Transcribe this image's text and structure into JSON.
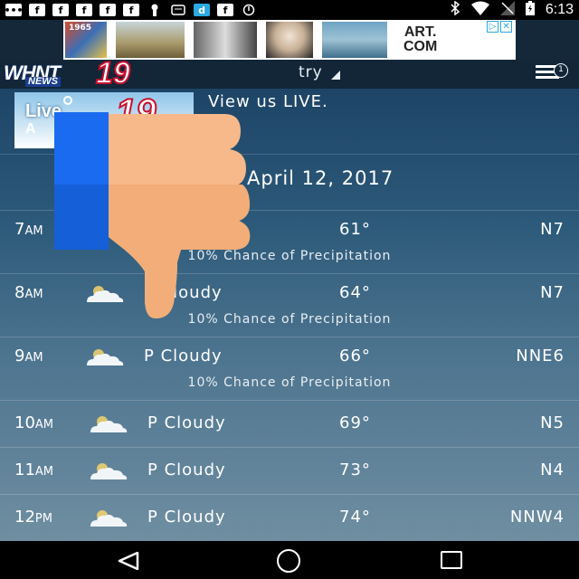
{
  "status_bar": {
    "time": "6:13",
    "icons": [
      "messages-icon",
      "facebook-icon",
      "facebook-icon",
      "facebook-icon",
      "facebook-icon",
      "facebook-icon",
      "keyhole-icon",
      "note-icon",
      "dictionary-icon",
      "facebook-icon",
      "sync-icon",
      "bluetooth-icon",
      "wifi-icon",
      "no-signal-icon",
      "battery-charging-icon"
    ]
  },
  "ad": {
    "thumb_year": "1965",
    "logo_line1": "ART.",
    "logo_line2": "COM",
    "badge_info": "▷",
    "badge_close": "✕"
  },
  "header": {
    "logo_text": "WHNT",
    "logo_news": "NEWS",
    "logo_number": "19",
    "location": "try",
    "menu_badge": "1"
  },
  "live": {
    "thumb_text": "Live",
    "thumb_sub": "A",
    "thumb_number": "19",
    "label": "View us LIVE."
  },
  "forecast": {
    "date": "April 12, 2017",
    "hours": [
      {
        "time": "7",
        "ampm": "AM",
        "condition": "",
        "temp": "61°",
        "wind": "N7",
        "precip": "10% Chance of Precipitation",
        "icon": false
      },
      {
        "time": "8",
        "ampm": "AM",
        "condition": "P Cloudy",
        "temp": "64°",
        "wind": "N7",
        "precip": "10% Chance of Precipitation",
        "icon": true
      },
      {
        "time": "9",
        "ampm": "AM",
        "condition": "P Cloudy",
        "temp": "66°",
        "wind": "NNE6",
        "precip": "10% Chance of Precipitation",
        "icon": true
      },
      {
        "time": "10",
        "ampm": "AM",
        "condition": "P Cloudy",
        "temp": "69°",
        "wind": "N5",
        "precip": "",
        "icon": true
      },
      {
        "time": "11",
        "ampm": "AM",
        "condition": "P Cloudy",
        "temp": "73°",
        "wind": "N4",
        "precip": "",
        "icon": true
      },
      {
        "time": "12",
        "ampm": "PM",
        "condition": "P Cloudy",
        "temp": "74°",
        "wind": "NNW4",
        "precip": "",
        "icon": true
      }
    ]
  },
  "colors": {
    "overlay_blue": "#1a6bef",
    "overlay_skin": "#f7b98a",
    "brand_red": "#c8102e"
  }
}
